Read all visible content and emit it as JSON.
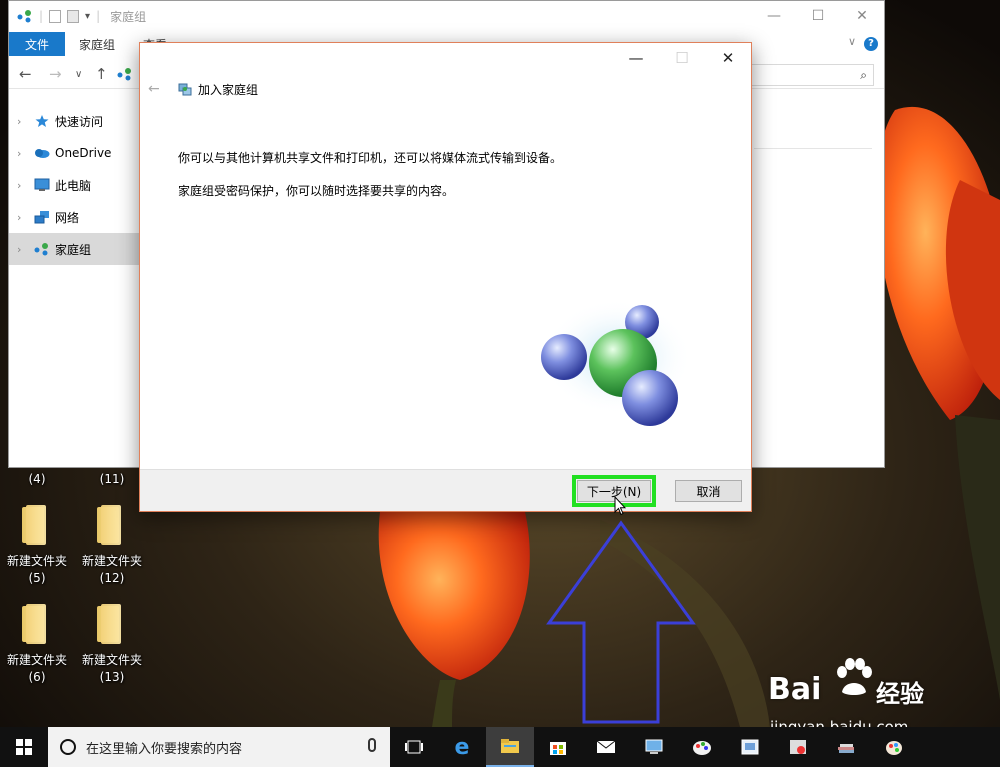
{
  "desktop": {
    "top_labels": [
      "(4)",
      "(11)"
    ],
    "folders": [
      {
        "name": "新建文件夹",
        "count": "(5)"
      },
      {
        "name": "新建文件夹",
        "count": "(12)"
      },
      {
        "name": "新建文件夹",
        "count": "(6)"
      },
      {
        "name": "新建文件夹",
        "count": "(13)"
      }
    ]
  },
  "explorer": {
    "title": "家庭组",
    "ribbon_tabs": [
      "文件",
      "家庭组",
      "查看"
    ],
    "sidebar": [
      {
        "label": "快速访问",
        "icon": "star-icon"
      },
      {
        "label": "OneDrive",
        "icon": "cloud-icon"
      },
      {
        "label": "此电脑",
        "icon": "computer-icon"
      },
      {
        "label": "网络",
        "icon": "network-icon"
      },
      {
        "label": "家庭组",
        "icon": "homegroup-icon",
        "selected": true
      }
    ]
  },
  "dialog": {
    "title": "加入家庭组",
    "text1": "你可以与其他计算机共享文件和打印机，还可以将媒体流式传输到设备。",
    "text2": "家庭组受密码保护，你可以随时选择要共享的内容。",
    "next_button": "下一步(N)",
    "cancel_button": "取消",
    "highlight_color": "#22e022"
  },
  "taskbar": {
    "search_placeholder": "在这里输入你要搜索的内容"
  },
  "watermark": {
    "brand": "Bai",
    "brand_suffix": "经验",
    "url": "jingyan.baidu.com"
  }
}
